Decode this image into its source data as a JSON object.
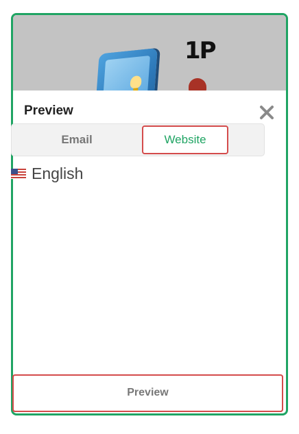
{
  "modal": {
    "title": "Preview",
    "close_icon": "close-icon",
    "tabs": [
      {
        "label": "Email",
        "active": false
      },
      {
        "label": "Website",
        "active": true
      }
    ],
    "language": {
      "flag_icon": "us-flag-icon",
      "label": "English"
    },
    "preview_button_label": "Preview"
  },
  "banner": {
    "logo_text": "1P",
    "icons": [
      "phone-illustration",
      "person-illustration"
    ]
  },
  "colors": {
    "frame_border": "#1fa463",
    "active_tab_text": "#1fa463",
    "highlight_border": "#d44b4b",
    "banner_bg": "#c3c3c3"
  }
}
